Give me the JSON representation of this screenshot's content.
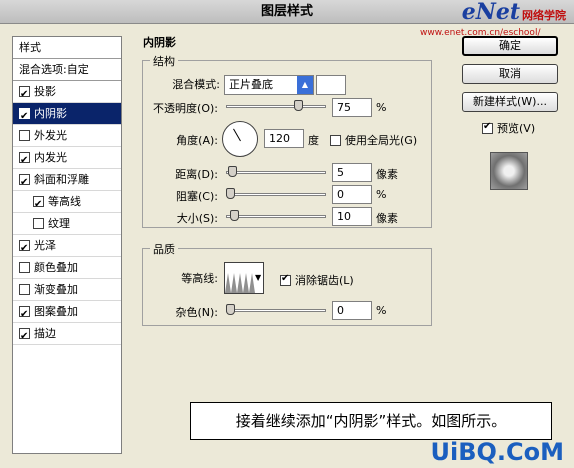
{
  "window": {
    "title": "图层样式"
  },
  "watermark": {
    "logo": "eNet",
    "logo_cn": "网络学院",
    "url": "www.enet.com.cn/eschool/"
  },
  "left_panel": {
    "header": "样式",
    "blend_options": "混合选项:自定",
    "items": [
      {
        "label": "投影",
        "checked": true
      },
      {
        "label": "内阴影",
        "checked": true,
        "selected": true
      },
      {
        "label": "外发光",
        "checked": false
      },
      {
        "label": "内发光",
        "checked": true
      },
      {
        "label": "斜面和浮雕",
        "checked": true
      },
      {
        "label": "等高线",
        "checked": true,
        "indent": true
      },
      {
        "label": "纹理",
        "checked": false,
        "indent": true
      },
      {
        "label": "光泽",
        "checked": true
      },
      {
        "label": "颜色叠加",
        "checked": false
      },
      {
        "label": "渐变叠加",
        "checked": false
      },
      {
        "label": "图案叠加",
        "checked": true
      },
      {
        "label": "描边",
        "checked": true
      }
    ]
  },
  "inner_shadow": {
    "section_title": "内阴影",
    "structure": {
      "title": "结构",
      "blend_mode_label": "混合模式:",
      "blend_mode_value": "正片叠底",
      "opacity_label": "不透明度(O):",
      "opacity_value": "75",
      "opacity_unit": "%",
      "opacity_level": 0.75,
      "angle_label": "角度(A):",
      "angle_value": "120",
      "angle_unit": "度",
      "global_light_label": "使用全局光(G)",
      "global_light_checked": false,
      "distance_label": "距离(D):",
      "distance_value": "5",
      "distance_unit": "像素",
      "choke_label": "阻塞(C):",
      "choke_value": "0",
      "choke_unit": "%",
      "size_label": "大小(S):",
      "size_value": "10",
      "size_unit": "像素"
    },
    "quality": {
      "title": "品质",
      "contour_label": "等高线:",
      "antialias_label": "消除锯齿(L)",
      "antialias_checked": true,
      "noise_label": "杂色(N):",
      "noise_value": "0",
      "noise_unit": "%"
    }
  },
  "buttons": {
    "ok": "确定",
    "cancel": "取消",
    "new_style": "新建样式(W)...",
    "preview_label": "预览(V)",
    "preview_checked": true
  },
  "caption": "接着继续添加“内阴影”样式。如图所示。",
  "footer_logo": "UiBQ.CoM"
}
